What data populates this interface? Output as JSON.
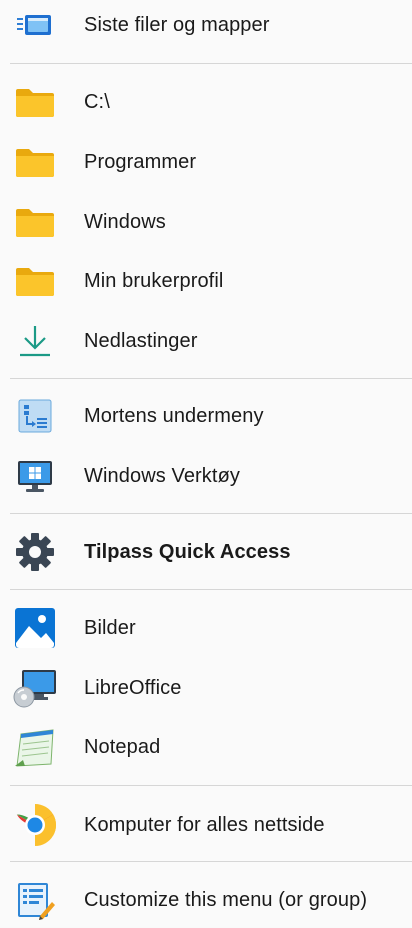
{
  "menu": {
    "items": [
      {
        "label": "Siste filer og mapper",
        "icon": "recent-files-icon"
      },
      {
        "label": "C:\\",
        "icon": "folder-icon"
      },
      {
        "label": "Programmer",
        "icon": "folder-icon"
      },
      {
        "label": "Windows",
        "icon": "folder-icon"
      },
      {
        "label": "Min brukerprofil",
        "icon": "folder-icon"
      },
      {
        "label": "Nedlastinger",
        "icon": "download-icon"
      },
      {
        "label": "Mortens undermeny",
        "icon": "submenu-icon"
      },
      {
        "label": "Windows Verktøy",
        "icon": "windows-tools-icon"
      },
      {
        "label": "Tilpass Quick Access",
        "icon": "gear-icon"
      },
      {
        "label": "Bilder",
        "icon": "photos-icon"
      },
      {
        "label": "LibreOffice",
        "icon": "libreoffice-icon"
      },
      {
        "label": "Notepad",
        "icon": "notepad-icon"
      },
      {
        "label": "Komputer for alles nettside",
        "icon": "chrome-icon"
      },
      {
        "label": "Customize this menu (or group)",
        "icon": "customize-menu-icon"
      }
    ]
  },
  "colors": {
    "folder": "#f8c21a",
    "download": "#1b9a86",
    "accent_blue": "#0a74d4",
    "gear": "#3a4654"
  }
}
